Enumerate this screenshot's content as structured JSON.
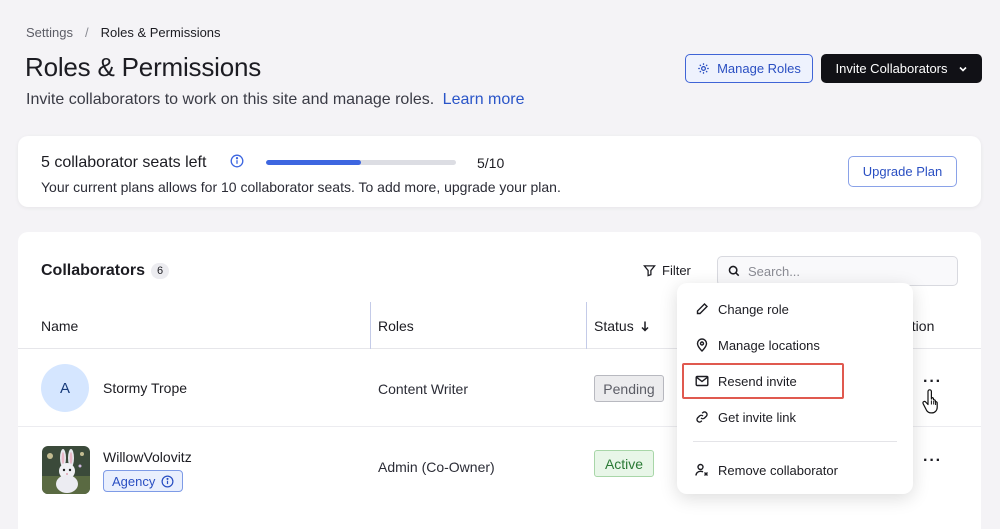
{
  "breadcrumb": {
    "parent": "Settings",
    "separator": "/",
    "current": "Roles & Permissions"
  },
  "header": {
    "title": "Roles & Permissions",
    "subtitle": "Invite collaborators to work on this site and manage roles.",
    "learn_more": "Learn more",
    "manage_roles_label": "Manage Roles",
    "invite_label": "Invite Collaborators"
  },
  "seats": {
    "title": "5 collaborator seats left",
    "progress_fraction": 0.5,
    "progress_label": "5/10",
    "description": "Your current plans allows for 10 collaborator seats. To add more, upgrade your plan.",
    "upgrade_label": "Upgrade Plan"
  },
  "collaborators": {
    "title": "Collaborators",
    "count": "6",
    "filter_label": "Filter",
    "search_placeholder": "Search...",
    "columns": {
      "name": "Name",
      "roles": "Roles",
      "status": "Status",
      "location": "ation"
    },
    "rows": [
      {
        "initial": "A",
        "name": "Stormy Trope",
        "role": "Content Writer",
        "status": "Pending"
      },
      {
        "name": "WillowVolovitz",
        "tag": "Agency",
        "role": "Admin (Co-Owner)",
        "status": "Active"
      }
    ]
  },
  "menu": {
    "items": [
      {
        "label": "Change role",
        "icon": "pencil-icon"
      },
      {
        "label": "Manage locations",
        "icon": "location-pin-icon"
      },
      {
        "label": "Resend invite",
        "icon": "envelope-icon"
      },
      {
        "label": "Get invite link",
        "icon": "link-icon"
      },
      {
        "label": "Remove collaborator",
        "icon": "remove-user-icon"
      }
    ]
  },
  "colors": {
    "accent": "#3d66e0",
    "highlight": "#e0594f",
    "dark_button": "#111116"
  }
}
